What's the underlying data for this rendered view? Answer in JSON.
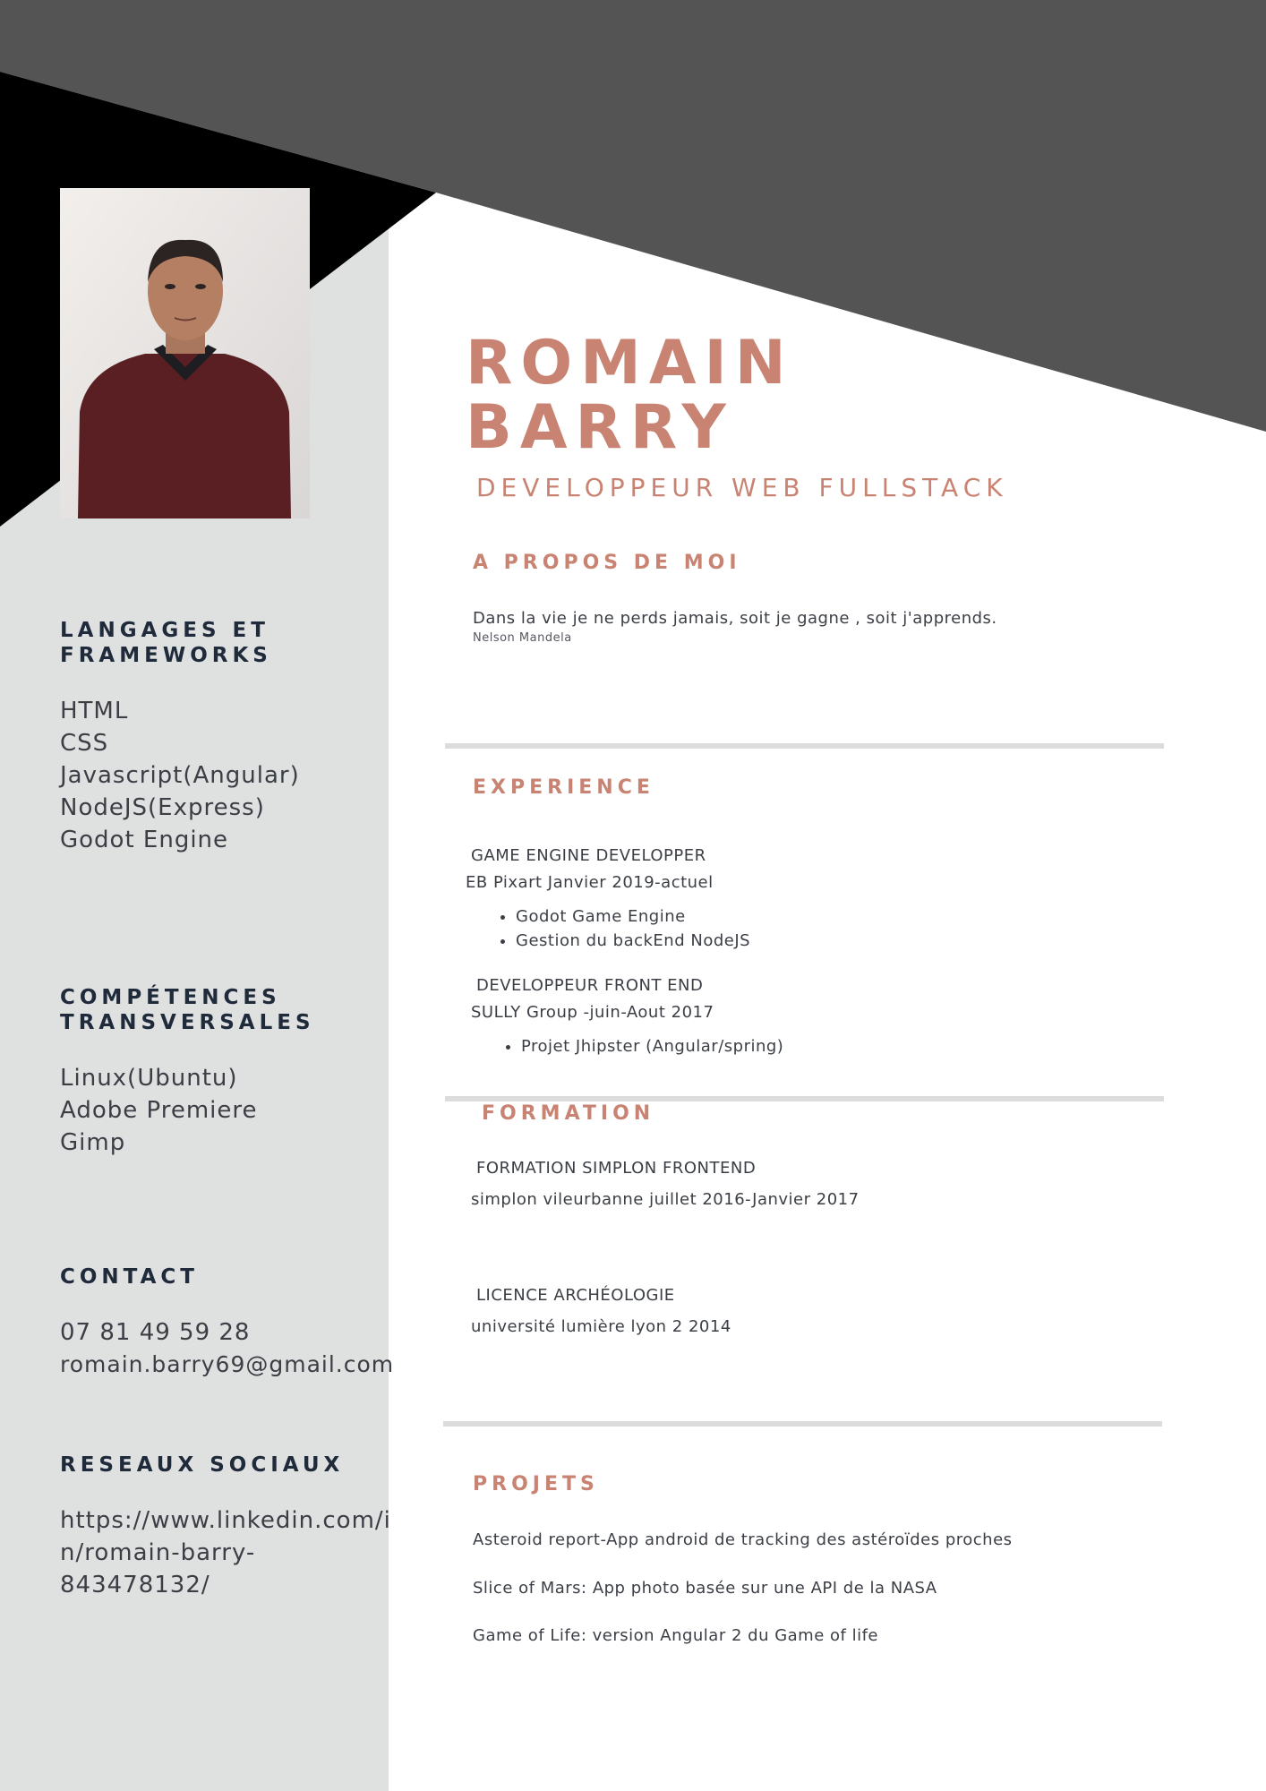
{
  "name": {
    "first": "ROMAIN",
    "last": "BARRY"
  },
  "job_title": "DEVELOPPEUR WEB FULLSTACK",
  "sidebar": {
    "languages": {
      "heading": "LANGAGES ET\nFRAMEWORKS",
      "items": [
        "HTML",
        "CSS",
        "Javascript(Angular)",
        "NodeJS(Express)",
        "Godot Engine"
      ]
    },
    "skills": {
      "heading": " COMPÉTENCES\nTRANSVERSALES",
      "items": [
        "Linux(Ubuntu)",
        "Adobe Premiere",
        "Gimp"
      ]
    },
    "contact": {
      "heading": "CONTACT",
      "items": [
        "07 81 49 59 28",
        "romain.barry69@gmail.com"
      ]
    },
    "social": {
      "heading": "RESEAUX SOCIAUX",
      "lines": [
        "https://www.linkedin.com/i",
        "n/romain-barry-",
        "843478132/"
      ]
    }
  },
  "about": {
    "heading": "A PROPOS DE MOI",
    "quote": "Dans la vie je ne perds jamais, soit je gagne , soit j'apprends.",
    "author": "Nelson Mandela"
  },
  "experience": {
    "heading": "EXPERIENCE",
    "jobs": [
      {
        "title": "GAME ENGINE DEVELOPPER",
        "company": "EB Pixart  Janvier 2019-actuel",
        "bullets": [
          "Godot Game Engine",
          "Gestion du backEnd NodeJS"
        ]
      },
      {
        "title": "DEVELOPPEUR FRONT END",
        "company": "SULLY Group -juin-Aout 2017",
        "bullets": [
          "Projet Jhipster (Angular/spring)"
        ]
      }
    ]
  },
  "formation": {
    "heading": "FORMATION",
    "items": [
      {
        "title": "FORMATION SIMPLON FRONTEND",
        "detail": "simplon vileurbanne juillet 2016-Janvier 2017"
      },
      {
        "title": "LICENCE ARCHÉOLOGIE",
        "detail": "université lumière lyon 2 2014"
      }
    ]
  },
  "projects": {
    "heading": "PROJETS",
    "items": [
      "Asteroid report-App android de tracking des astéroïdes proches",
      "Slice of Mars: App photo basée sur une API de la NASA",
      "Game of Life: version Angular 2 du Game of life"
    ]
  },
  "colors": {
    "accent": "#c98372",
    "dark": "#1f2a3a",
    "sidebar": "#dfe0e0",
    "banner": "#545454"
  }
}
